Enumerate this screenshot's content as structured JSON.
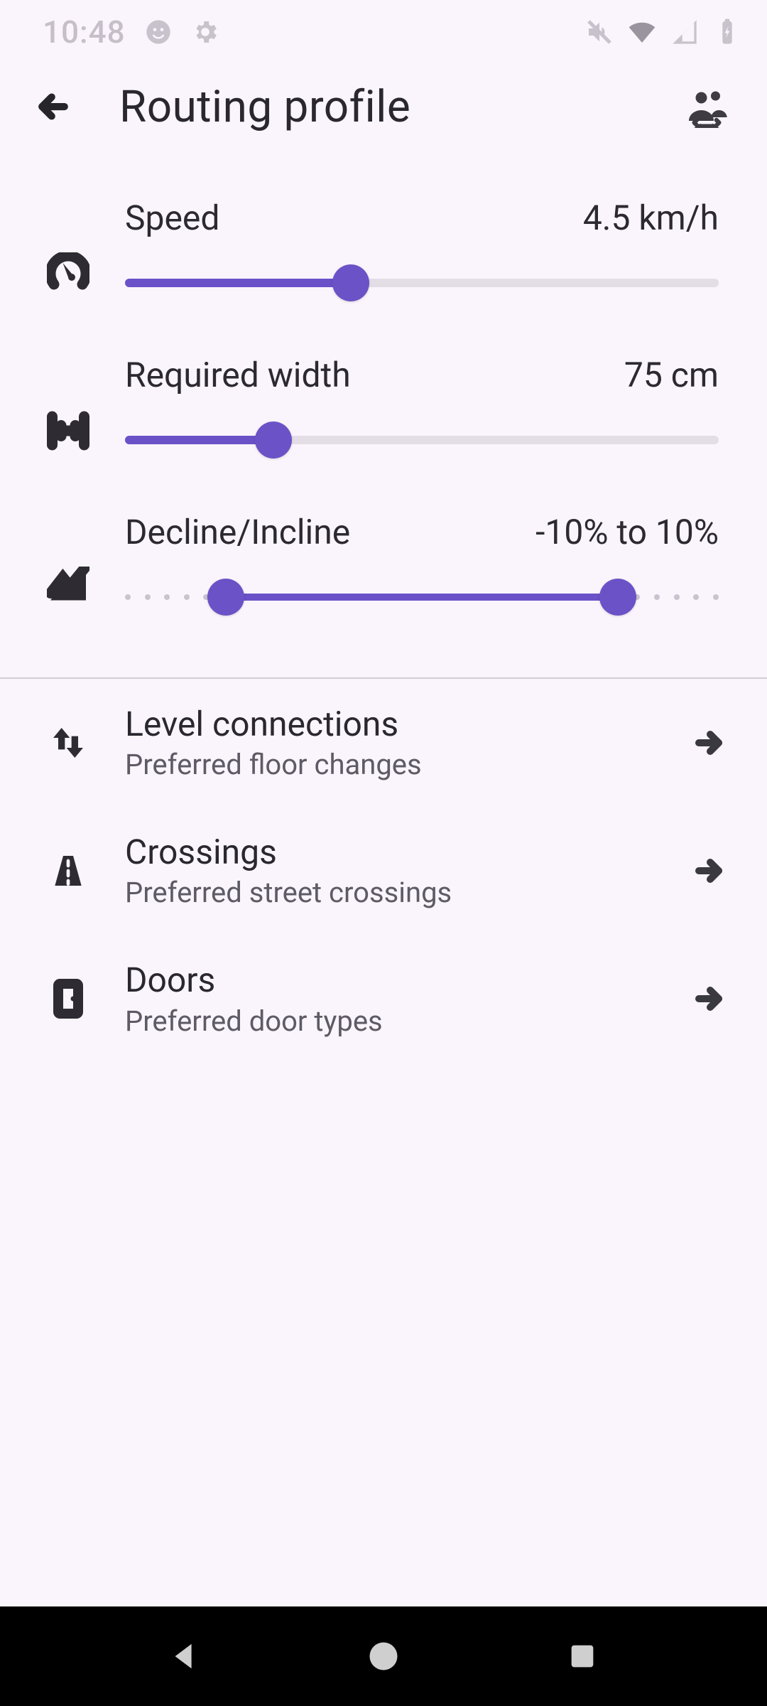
{
  "status": {
    "time": "10:48"
  },
  "appbar": {
    "title": "Routing profile"
  },
  "sliders": {
    "speed": {
      "label": "Speed",
      "value": "4.5 km/h",
      "pct": 38
    },
    "width": {
      "label": "Required width",
      "value": "75 cm",
      "pct": 25
    },
    "incline": {
      "label": "Decline/Incline",
      "value": "-10% to 10%",
      "lowPct": 17,
      "highPct": 83
    }
  },
  "nav": {
    "level": {
      "title": "Level connections",
      "sub": "Preferred floor changes"
    },
    "crossing": {
      "title": "Crossings",
      "sub": "Preferred street crossings"
    },
    "doors": {
      "title": "Doors",
      "sub": "Preferred door types"
    }
  }
}
